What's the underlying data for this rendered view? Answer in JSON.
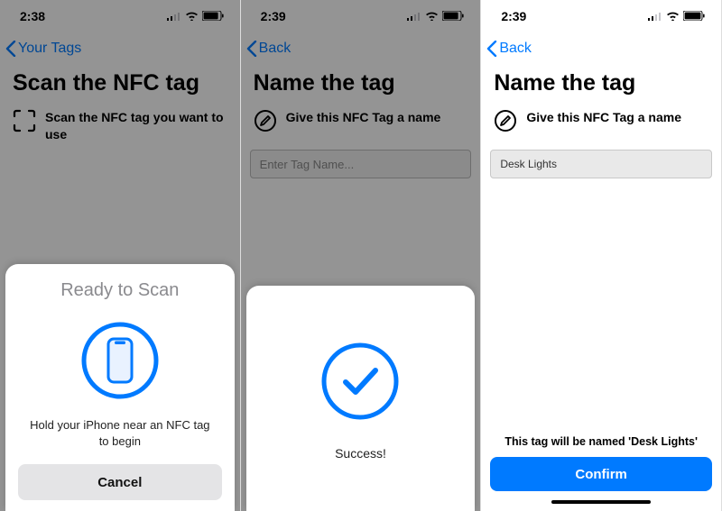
{
  "screen1": {
    "time": "2:38",
    "back_label": "Your Tags",
    "title": "Scan the NFC tag",
    "instruction": "Scan the NFC tag you want to use",
    "sheet": {
      "title": "Ready to Scan",
      "message": "Hold your iPhone near an NFC tag to begin",
      "cancel": "Cancel"
    }
  },
  "screen2": {
    "time": "2:39",
    "back_label": "Back",
    "title": "Name the tag",
    "instruction": "Give this NFC Tag a name",
    "placeholder": "Enter Tag Name...",
    "sheet": {
      "message": "Success!"
    }
  },
  "screen3": {
    "time": "2:39",
    "back_label": "Back",
    "title": "Name the tag",
    "instruction": "Give this NFC Tag a name",
    "input_value": "Desk Lights",
    "footer_note": "This tag will be named 'Desk Lights'",
    "confirm": "Confirm"
  }
}
